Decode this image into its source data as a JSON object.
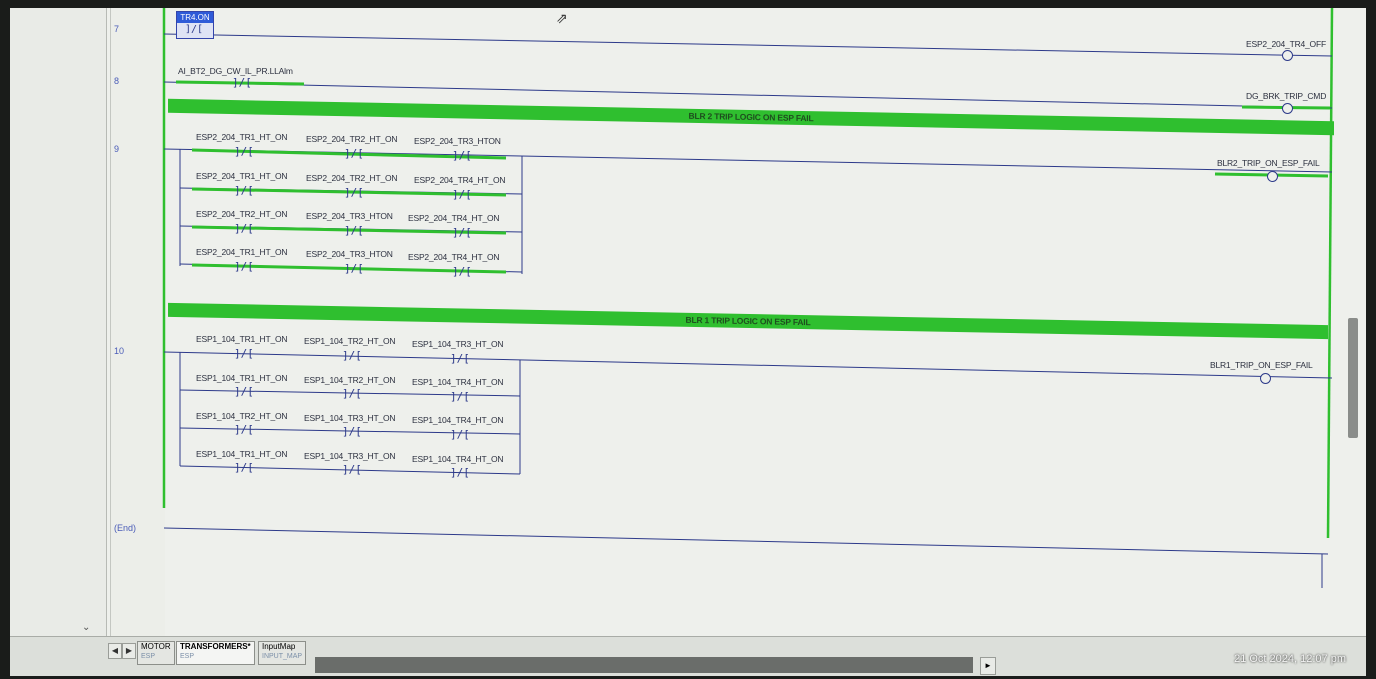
{
  "rungs": {
    "r7": "7",
    "r8": "8",
    "r9": "9",
    "r10": "10",
    "end": "(End)"
  },
  "rung7": {
    "box_tag": "TR4.ON",
    "coil": "ESP2_204_TR4_OFF"
  },
  "rung8": {
    "contact": "AI_BT2_DG_CW_IL_PR.LLAlm",
    "coil": "DG_BRK_TRIP_CMD"
  },
  "rung9": {
    "comment": "BLR 2 TRIP LOGIC ON ESP FAIL",
    "coil": "BLR2_TRIP_ON_ESP_FAIL",
    "rows": [
      [
        "ESP2_204_TR1_HT_ON",
        "ESP2_204_TR2_HT_ON",
        "ESP2_204_TR3_HTON"
      ],
      [
        "ESP2_204_TR1_HT_ON",
        "ESP2_204_TR2_HT_ON",
        "ESP2_204_TR4_HT_ON"
      ],
      [
        "ESP2_204_TR2_HT_ON",
        "ESP2_204_TR3_HTON",
        "ESP2_204_TR4_HT_ON"
      ],
      [
        "ESP2_204_TR1_HT_ON",
        "ESP2_204_TR3_HTON",
        "ESP2_204_TR4_HT_ON"
      ]
    ]
  },
  "rung10": {
    "comment": "BLR 1 TRIP LOGIC ON ESP FAIL",
    "coil": "BLR1_TRIP_ON_ESP_FAIL",
    "rows": [
      [
        "ESP1_104_TR1_HT_ON",
        "ESP1_104_TR2_HT_ON",
        "ESP1_104_TR3_HT_ON"
      ],
      [
        "ESP1_104_TR1_HT_ON",
        "ESP1_104_TR2_HT_ON",
        "ESP1_104_TR4_HT_ON"
      ],
      [
        "ESP1_104_TR2_HT_ON",
        "ESP1_104_TR3_HT_ON",
        "ESP1_104_TR4_HT_ON"
      ],
      [
        "ESP1_104_TR1_HT_ON",
        "ESP1_104_TR3_HT_ON",
        "ESP1_104_TR4_HT_ON"
      ]
    ]
  },
  "tabs": [
    {
      "label": "MOTOR",
      "sub": "ESP"
    },
    {
      "label": "TRANSFORMERS*",
      "sub": "ESP"
    },
    {
      "label": "InputMap",
      "sub": "INPUT_MAP"
    }
  ],
  "timestamp": "21 Oct 2024, 12:07 pm",
  "colors": {
    "energized": "#2fbf2f",
    "wire": "#2d3a8a",
    "background": "#eef0ec"
  },
  "icons": {
    "contact": "]/[",
    "cursor": "pointer-cursor-icon"
  }
}
